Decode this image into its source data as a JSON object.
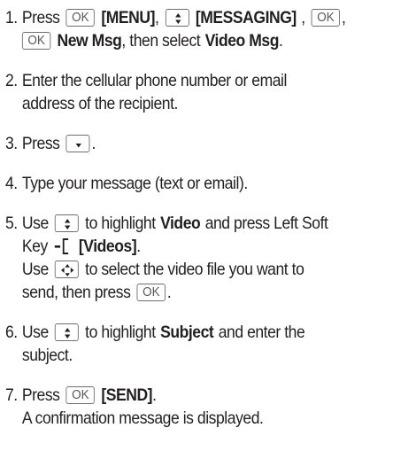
{
  "ok_key": "OK",
  "steps": [
    {
      "num": "1.",
      "t1": "Press",
      "menu": "[MENU]",
      "comma1": ",",
      "messaging": "[MESSAGING]",
      "comma2": ",",
      "comma3": ",",
      "new_msg": "New Msg",
      "then_select": ", then select",
      "video_msg": "Video Msg",
      "period": "."
    },
    {
      "num": "2.",
      "line1": "Enter the cellular phone number or email",
      "line2": "address of the recipient."
    },
    {
      "num": "3.",
      "t1": "Press",
      "period": "."
    },
    {
      "num": "4.",
      "line1": "Type your message (text or email)."
    },
    {
      "num": "5.",
      "use": "Use",
      "to_highlight": "to highlight",
      "video": "Video",
      "press_left_soft": "and press Left Soft",
      "key": "Key",
      "videos": "[Videos]",
      "period": ".",
      "use2": "Use",
      "select_text": "to select the video file you want to",
      "send_then": "send, then press",
      "period2": "."
    },
    {
      "num": "6.",
      "use": "Use",
      "to_highlight": "to highlight",
      "subject": "Subject",
      "enter_the": "and enter the",
      "line2": "subject."
    },
    {
      "num": "7.",
      "t1": "Press",
      "send": "[SEND]",
      "period": ".",
      "line2": "A confirmation message is displayed."
    }
  ]
}
